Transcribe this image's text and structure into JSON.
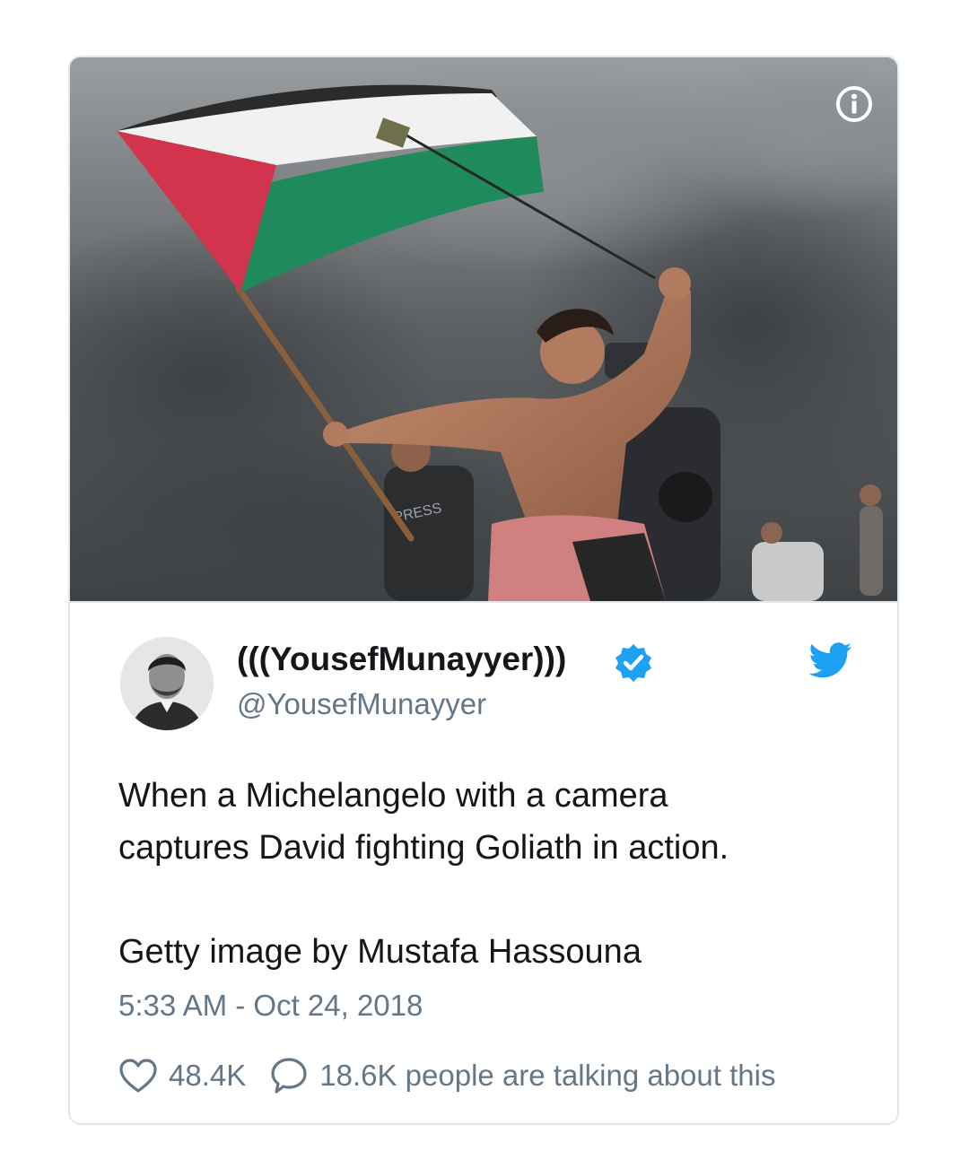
{
  "tweet": {
    "display_name": "(((YousefMunayyer)))",
    "handle": "@YousefMunayyer",
    "text_line1": "When a Michelangelo with a camera",
    "text_line2": "captures David fighting Goliath in action.",
    "text_line3": "Getty image by Mustafa Hassouna",
    "timestamp": "5:33 AM - Oct 24, 2018",
    "like_count": "48.4K",
    "talking_text": "18.6K people are talking about this",
    "verified": true
  },
  "photo": {
    "vest_text": "PRESS"
  },
  "colors": {
    "accent": "#1da1f2",
    "text": "#14171a",
    "muted": "#657786",
    "border": "#e1e8ed",
    "flag_red": "#d1344c",
    "flag_green": "#1f8a5c",
    "flag_black": "#2b2b2b"
  },
  "icons": {
    "info": "info-icon",
    "verified": "verified-badge-icon",
    "twitter": "twitter-bird-icon",
    "like": "heart-icon",
    "reply": "speech-bubble-icon"
  }
}
